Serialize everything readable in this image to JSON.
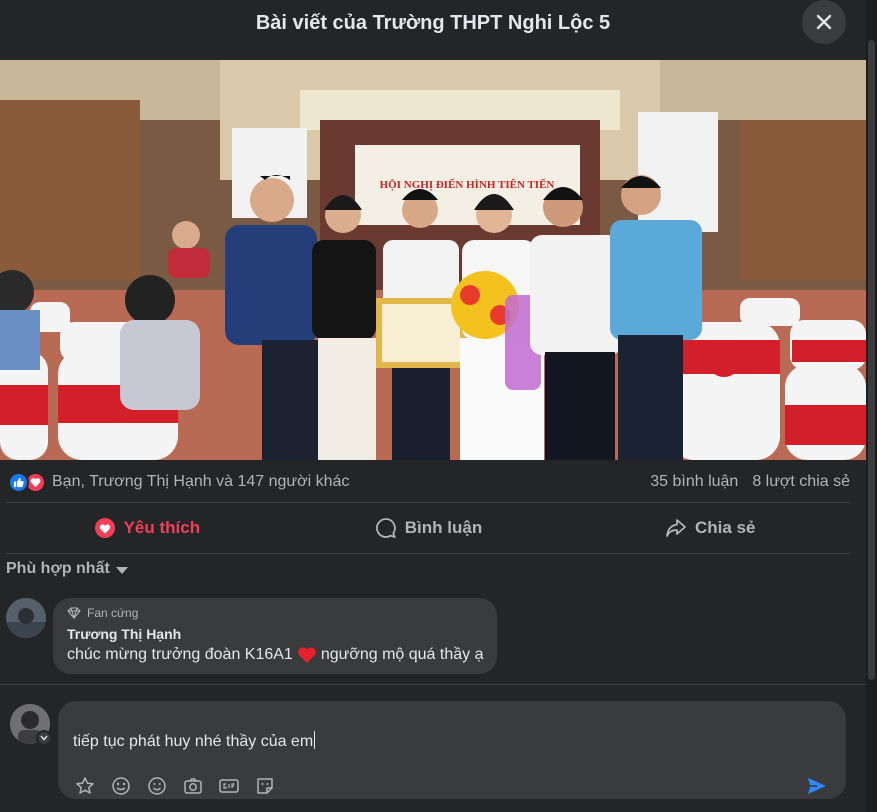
{
  "header": {
    "title": "Bài viết của Trường THPT Nghi Lộc 5"
  },
  "photo": {
    "banner_text": "HỘI NGHỊ ĐIỂN HÌNH TIÊN TIẾN"
  },
  "reactions": {
    "names": "Bạn, Trương Thị Hạnh và 147 người khác",
    "comments": "35 bình luận",
    "shares": "8 lượt chia sẻ"
  },
  "actions": {
    "like": "Yêu thích",
    "comment": "Bình luận",
    "share": "Chia sẻ"
  },
  "sort": {
    "label": "Phù hợp nhất"
  },
  "comment": {
    "badge": "Fan cứng",
    "author": "Trương Thị Hạnh",
    "text_before": "chúc mừng trưởng đoàn K16A1",
    "text_after": "ngưỡng mộ quá thầy ạ"
  },
  "composer": {
    "value": "tiếp tục phát huy nhé thầy của em"
  },
  "colors": {
    "accent": "#f33e58",
    "like_blue": "#1877f2",
    "send_blue": "#2d88ff"
  }
}
